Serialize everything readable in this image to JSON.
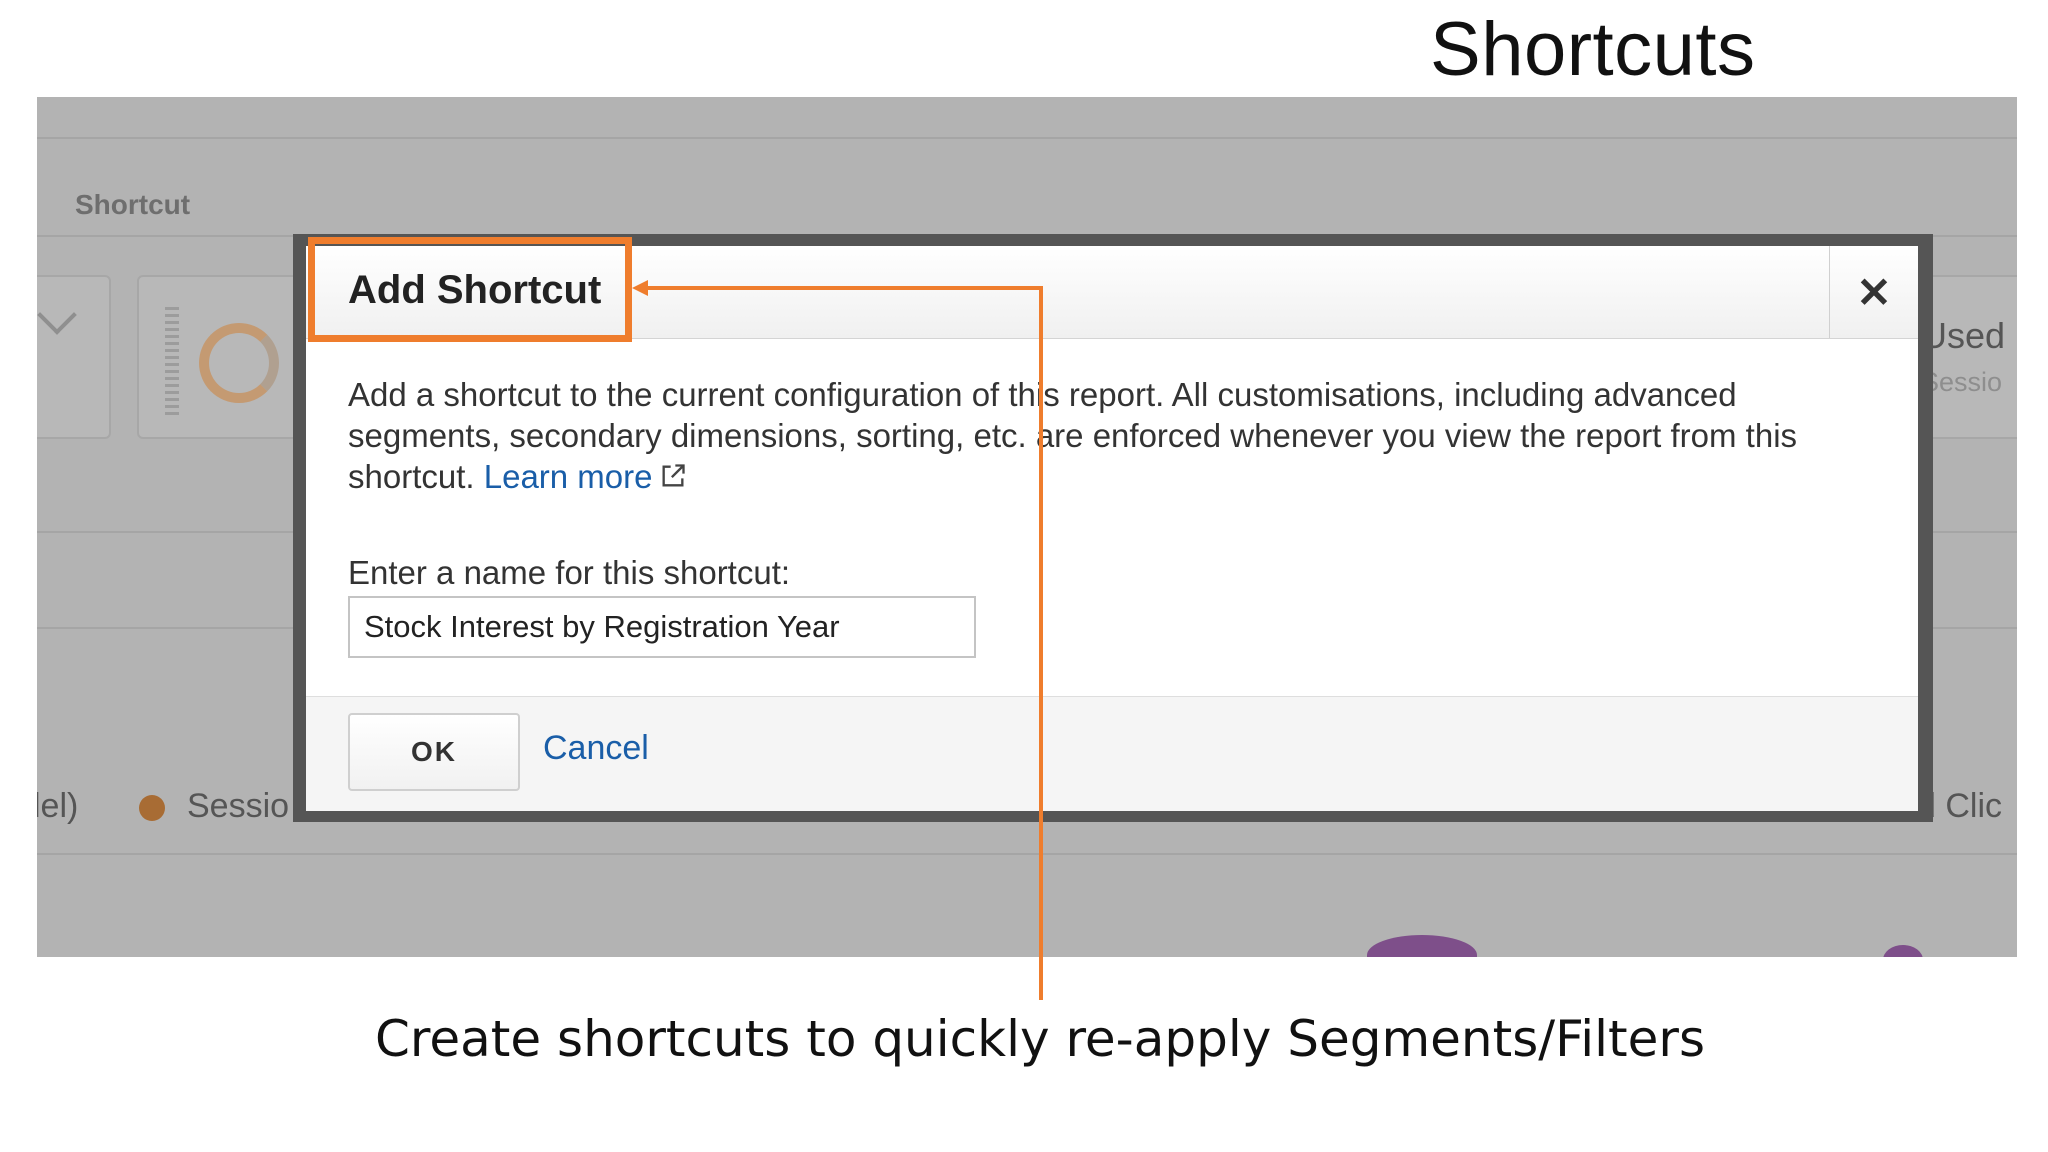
{
  "slide": {
    "title": "Shortcuts",
    "caption": "Create shortcuts to quickly re-apply Segments/Filters"
  },
  "background": {
    "tab_label": "Shortcut",
    "right_label_1": "Used",
    "right_label_2": "Sessio",
    "legend_left": "lel)",
    "legend_session": "Sessio",
    "legend_right": "d Clic"
  },
  "dialog": {
    "title": "Add Shortcut",
    "close_symbol": "✕",
    "description": "Add a shortcut to the current configuration of this report. All customisations, including advanced segments, secondary dimensions, sorting, etc. are enforced whenever you view the report from this shortcut.",
    "learn_more": "Learn more",
    "field_label": "Enter a name for this shortcut:",
    "field_value": "Stock Interest by Registration Year",
    "ok_label": "OK",
    "cancel_label": "Cancel"
  },
  "colors": {
    "highlight": "#ef7d2d",
    "link": "#1a5ea8",
    "overlay": "#b3b3b3"
  }
}
